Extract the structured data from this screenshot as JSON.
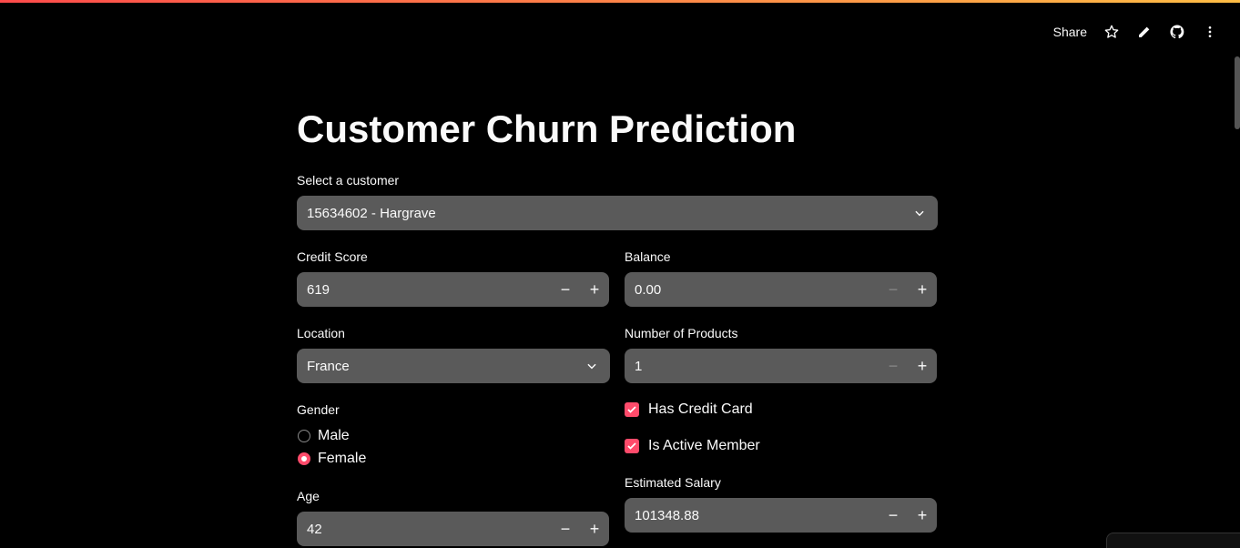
{
  "toolbar": {
    "share_label": "Share"
  },
  "title": "Customer Churn Prediction",
  "customer_select": {
    "label": "Select a customer",
    "value": "15634602 - Hargrave"
  },
  "credit_score": {
    "label": "Credit Score",
    "value": "619"
  },
  "balance": {
    "label": "Balance",
    "value": "0.00"
  },
  "location": {
    "label": "Location",
    "value": "France"
  },
  "num_products": {
    "label": "Number of Products",
    "value": "1"
  },
  "gender": {
    "label": "Gender",
    "options": [
      "Male",
      "Female"
    ],
    "selected": "Female"
  },
  "has_credit_card": {
    "label": "Has Credit Card",
    "checked": true
  },
  "is_active_member": {
    "label": "Is Active Member",
    "checked": true
  },
  "age": {
    "label": "Age",
    "value": "42"
  },
  "estimated_salary": {
    "label": "Estimated Salary",
    "value": "101348.88"
  },
  "stepper": {
    "minus": "−",
    "plus": "+"
  },
  "colors": {
    "accent": "#ff4b6b",
    "field_bg": "#5a5a5a",
    "background": "#000000"
  }
}
